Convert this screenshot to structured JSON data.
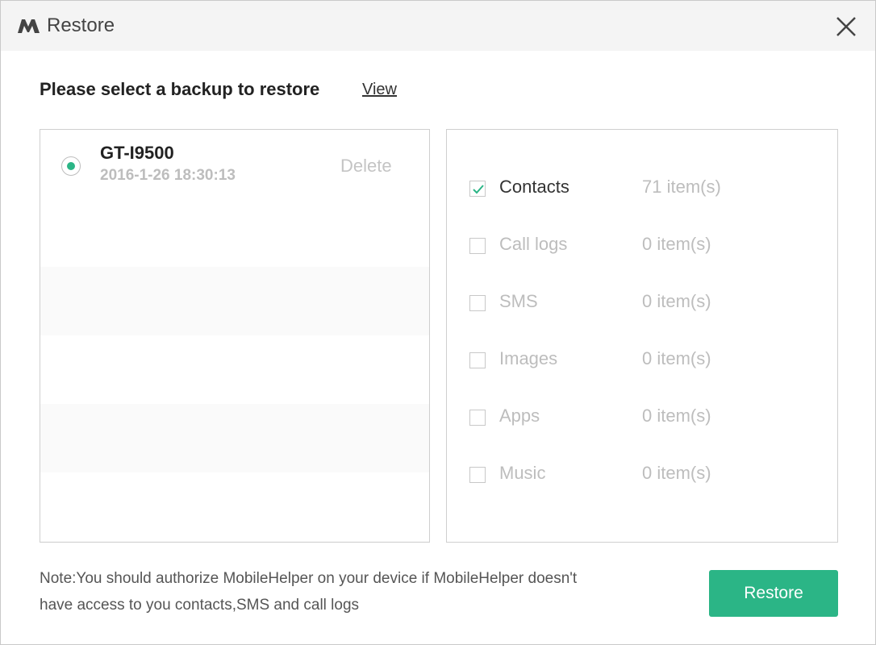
{
  "window": {
    "title": "Restore"
  },
  "heading": "Please select a backup to restore",
  "view_link": "View",
  "backups": [
    {
      "device": "GT-I9500",
      "date": "2016-1-26 18:30:13",
      "delete_label": "Delete",
      "selected": true
    }
  ],
  "categories": [
    {
      "label": "Contacts",
      "count": "71 item(s)",
      "checked": true
    },
    {
      "label": "Call logs",
      "count": "0 item(s)",
      "checked": false
    },
    {
      "label": "SMS",
      "count": "0 item(s)",
      "checked": false
    },
    {
      "label": "Images",
      "count": "0 item(s)",
      "checked": false
    },
    {
      "label": "Apps",
      "count": "0 item(s)",
      "checked": false
    },
    {
      "label": "Music",
      "count": "0 item(s)",
      "checked": false
    }
  ],
  "note_line1": "Note:You should authorize MobileHelper on your device if MobileHelper doesn't",
  "note_line2": "have access to you contacts,SMS and call logs",
  "restore_button": "Restore",
  "colors": {
    "accent": "#2bb586",
    "titlebar": "#f4f4f4",
    "muted_text": "#bdbdbd"
  },
  "icons": {
    "logo": "mobilehelper-logo-icon",
    "close": "close-icon",
    "check": "check-icon"
  }
}
